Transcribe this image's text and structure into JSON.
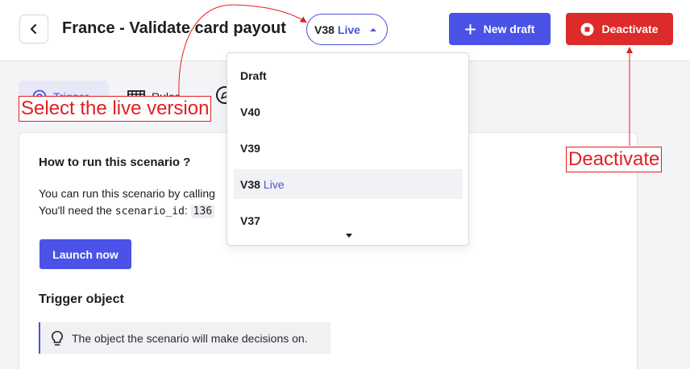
{
  "header": {
    "title": "France - Validate card payout",
    "version": {
      "number": "V38",
      "status": "Live"
    },
    "new_draft_label": "New draft",
    "deactivate_label": "Deactivate"
  },
  "tabs": [
    {
      "label": "Trigger",
      "icon": "target-icon",
      "active": true
    },
    {
      "label": "Rules",
      "icon": "table-icon",
      "active": false
    },
    {
      "label": "",
      "icon": "compass-icon",
      "active": false
    }
  ],
  "main": {
    "run_heading": "How to run this scenario ?",
    "run_text_1": "You can run this scenario by calling",
    "run_text_2_prefix": "You'll need the ",
    "run_text_2_code": "scenario_id",
    "run_text_2_sep": ": ",
    "run_text_2_id": "136",
    "launch_label": "Launch now",
    "trigger_heading": "Trigger object",
    "callout_icon": "lightbulb-icon",
    "callout_text": "The object the scenario will make decisions on."
  },
  "version_dropdown": {
    "items": [
      {
        "label": "Draft",
        "badge": ""
      },
      {
        "label": "V40",
        "badge": ""
      },
      {
        "label": "V39",
        "badge": ""
      },
      {
        "label": "V38",
        "badge": "Live",
        "selected": true
      },
      {
        "label": "V37",
        "badge": ""
      }
    ]
  },
  "annotations": {
    "select_live": "Select the live version",
    "deactivate": "Deactivate",
    "color": "#e02020"
  },
  "colors": {
    "accent": "#4a52e8",
    "danger": "#dd2a2a",
    "live_text": "#4a52d9"
  }
}
